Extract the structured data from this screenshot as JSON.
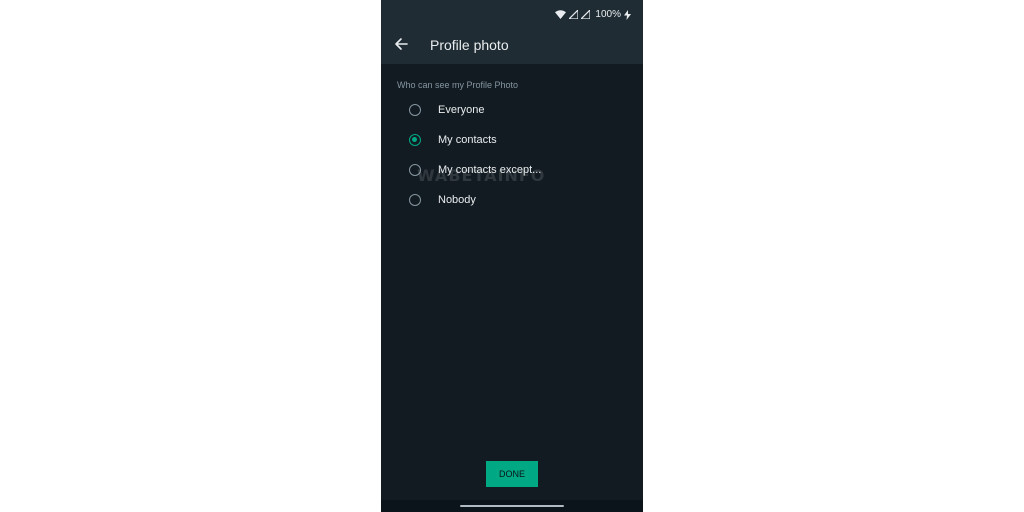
{
  "status_bar": {
    "battery": "100%",
    "icons": [
      "wifi-icon",
      "signal-icon",
      "signal-icon",
      "charging-icon"
    ]
  },
  "header": {
    "title": "Profile photo",
    "back_icon": "back-arrow-icon"
  },
  "privacy": {
    "section_label": "Who can see my Profile Photo",
    "options": [
      {
        "label": "Everyone",
        "selected": false
      },
      {
        "label": "My contacts",
        "selected": true
      },
      {
        "label": "My contacts except...",
        "selected": false
      },
      {
        "label": "Nobody",
        "selected": false
      }
    ]
  },
  "watermark": "WABETAINFO",
  "done_label": "DONE",
  "colors": {
    "accent": "#00a884",
    "background": "#121b22",
    "bar": "#1f2c34",
    "text_primary": "#e9edef",
    "text_secondary": "#8696a0"
  }
}
